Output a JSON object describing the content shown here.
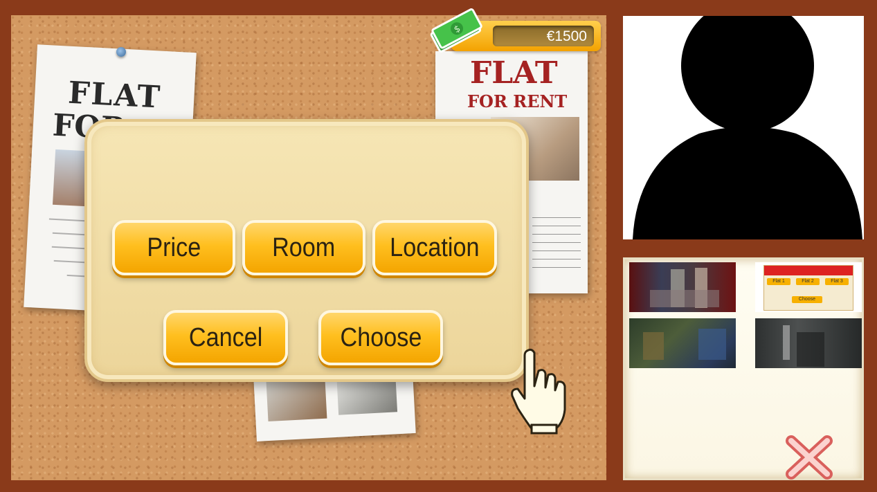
{
  "money": {
    "value": "€1500"
  },
  "posters": {
    "left": {
      "line1": "FLAT",
      "line2": "FOR"
    },
    "right": {
      "line1": "FLAT",
      "line2": "FOR RENT"
    }
  },
  "dialog": {
    "buttons": {
      "price": "Price",
      "room": "Room",
      "location": "Location",
      "cancel": "Cancel",
      "choose": "Choose"
    }
  },
  "thumbnails": {
    "shop": {
      "flat1": "Flat 1",
      "flat2": "Flat 2",
      "flat3": "Flat 3",
      "choose": "Choose"
    }
  },
  "colors": {
    "frame": "#8a3a1a",
    "cork": "#d49a62",
    "button": "#ffbf1f",
    "dialog": "#f6e6b5",
    "close_x": "#e07a7a"
  },
  "icons": [
    "cash-icon",
    "hand-pointer-icon",
    "user-silhouette-icon",
    "close-icon",
    "pin-icon"
  ]
}
